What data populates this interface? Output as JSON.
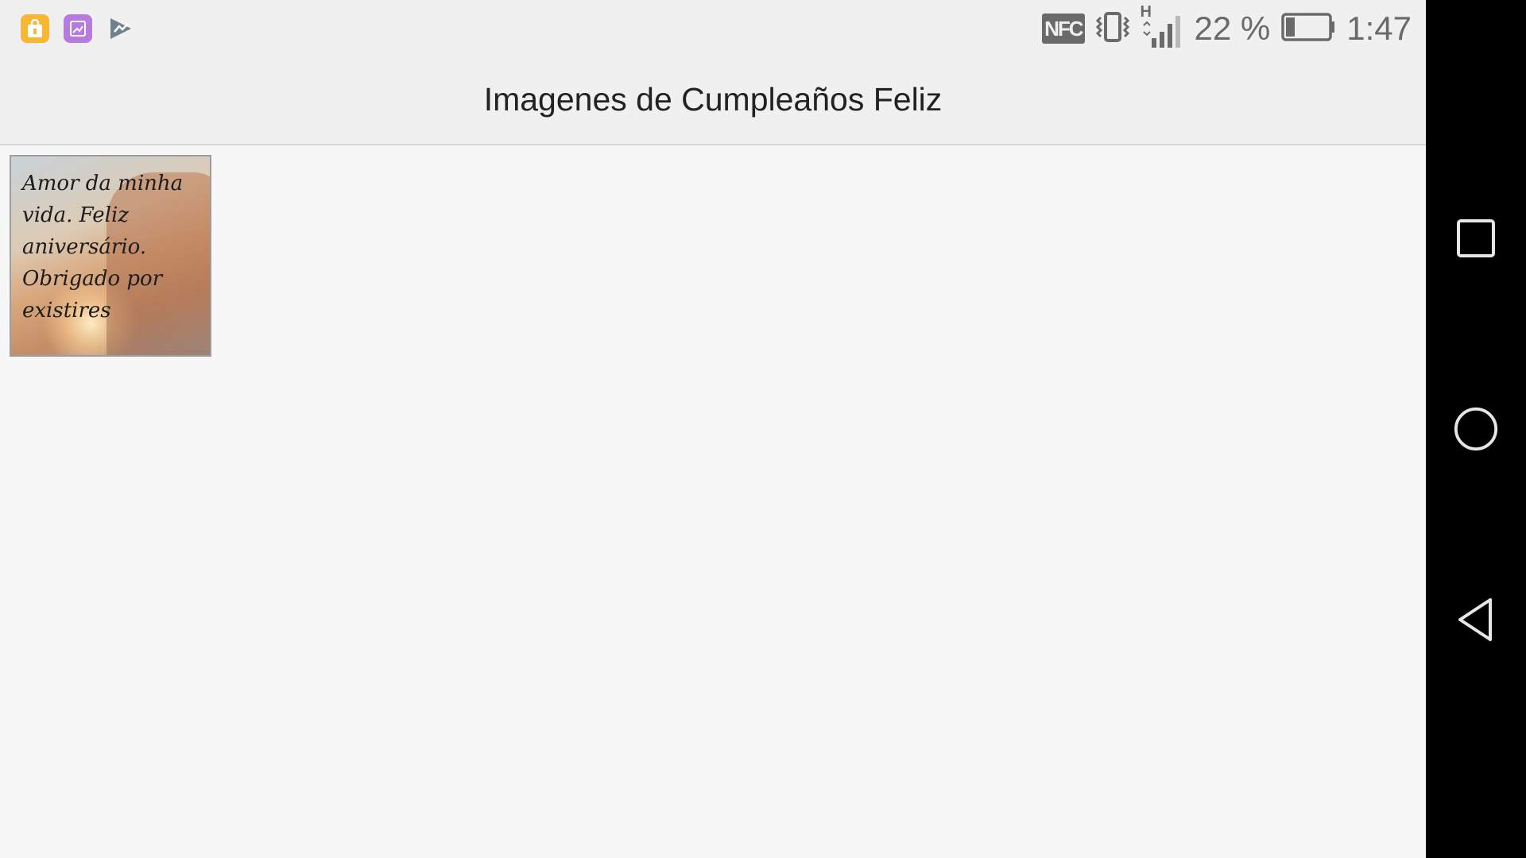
{
  "status_bar": {
    "notification_icons": [
      "shopping-bag-icon",
      "gallery-icon",
      "play-store-icon"
    ],
    "battery_percent": "22 %",
    "time": "1:47",
    "network_type": "H",
    "nfc_label": "NFC",
    "battery_level": 0.22
  },
  "app_bar": {
    "title": "Imagenes de Cumpleaños Feliz"
  },
  "images": [
    {
      "caption": "Amor da minha\nvida. Feliz\naniversário.\nObrigado por\nexistires"
    }
  ],
  "nav_bar": {
    "buttons": [
      "recents-icon",
      "home-icon",
      "back-icon"
    ]
  },
  "colors": {
    "background": "#f7f7f7",
    "app_bar": "#f0f0f0",
    "nav_bar": "#000000",
    "status_icon": "#6a6a6a"
  }
}
